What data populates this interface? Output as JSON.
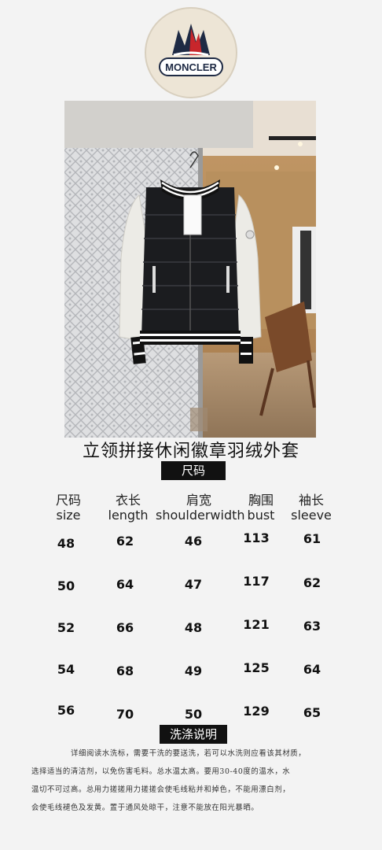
{
  "brand": {
    "logo_text": "MONCLER"
  },
  "product": {
    "title": "立领拼接休闲徽章羽绒外套"
  },
  "size_chart": {
    "label": "尺码",
    "columns": [
      {
        "zh": "尺码",
        "en": "size"
      },
      {
        "zh": "衣长",
        "en": "length"
      },
      {
        "zh": "肩宽",
        "en": "shoulderwidth"
      },
      {
        "zh": "胸围",
        "en": "bust"
      },
      {
        "zh": "袖长",
        "en": "sleeve"
      }
    ],
    "rows": [
      [
        "48",
        "62",
        "46",
        "113",
        "61"
      ],
      [
        "50",
        "64",
        "47",
        "117",
        "62"
      ],
      [
        "52",
        "66",
        "48",
        "121",
        "63"
      ],
      [
        "54",
        "68",
        "49",
        "125",
        "64"
      ],
      [
        "56",
        "70",
        "50",
        "129",
        "65"
      ]
    ]
  },
  "care": {
    "label": "洗涤说明",
    "lines": [
      "详细阅读水洗标，需要干洗的要送洗，若可以水洗则应看该其材质，",
      "选择适当的清洁剂，以免伤害毛料。总水温太高。要用30-40度的温水，水",
      "温切不可过高。总用力搓搓用力搓搓会使毛线粘并和掉色，不能用漂白剂，",
      "会使毛线褪色及发黄。置于通风处晾干，注意不能放在阳光暴晒。"
    ]
  }
}
